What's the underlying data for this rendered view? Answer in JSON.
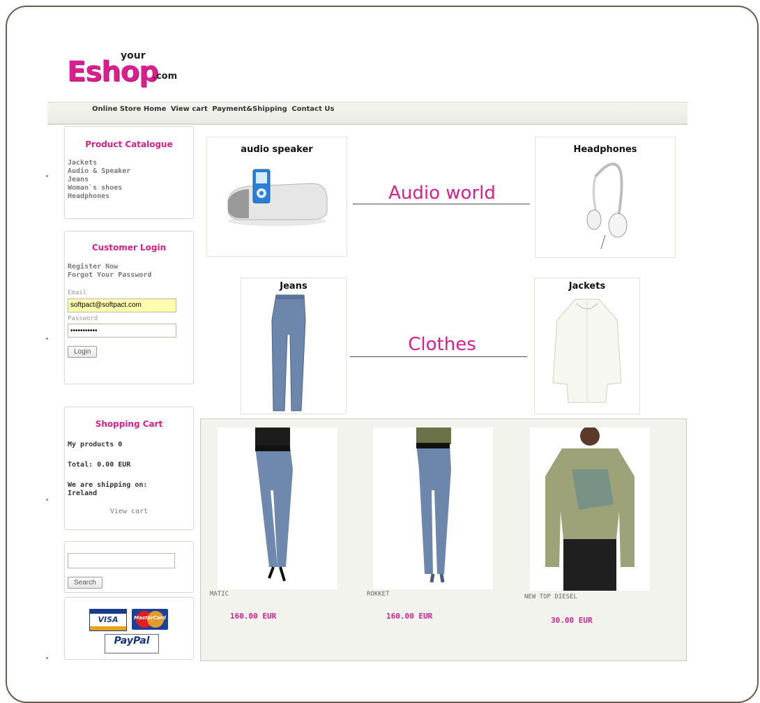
{
  "logo": {
    "main": "Eshop",
    "top": "your",
    "suffix": ".com"
  },
  "nav": [
    "Online Store Home",
    "View cart",
    "Payment&Shipping",
    "Contact Us"
  ],
  "catalogue": {
    "title": "Product Catalogue",
    "items": [
      "Jackets",
      "Audio & Speaker",
      "Jeans",
      "Woman`s shoes",
      "Headphones"
    ]
  },
  "login": {
    "title": "Customer Login",
    "register": "Register Now",
    "forgot": "Forgot Your Password",
    "email_label": "Email",
    "email_value": "softpact@softpact.com",
    "password_label": "Password",
    "password_value": "•••••••••••",
    "button": "Login"
  },
  "cart": {
    "title": "Shopping Cart",
    "products": "My products 0",
    "total": "Total: 0.00 EUR",
    "shipping": "We are shipping on:",
    "country": "Ireland",
    "view": "View cart"
  },
  "search": {
    "button": "Search",
    "value": ""
  },
  "payments": {
    "visa": "VISA",
    "mastercard": "MasterCard",
    "paypal": "PayPal"
  },
  "categories": {
    "speaker": "audio speaker",
    "headphones": "Headphones",
    "audio_label": "Audio world",
    "jeans": "Jeans",
    "jackets": "Jackets",
    "clothes_label": "Clothes"
  },
  "products": [
    {
      "name": "MATIC",
      "price": "160.00 EUR"
    },
    {
      "name": "ROKKET",
      "price": "160.00 EUR"
    },
    {
      "name": "NEW TOP DIESEL",
      "price": "30.00 EUR"
    }
  ],
  "colors": {
    "brand": "#d81f8d",
    "frame": "#6b5a4e"
  }
}
